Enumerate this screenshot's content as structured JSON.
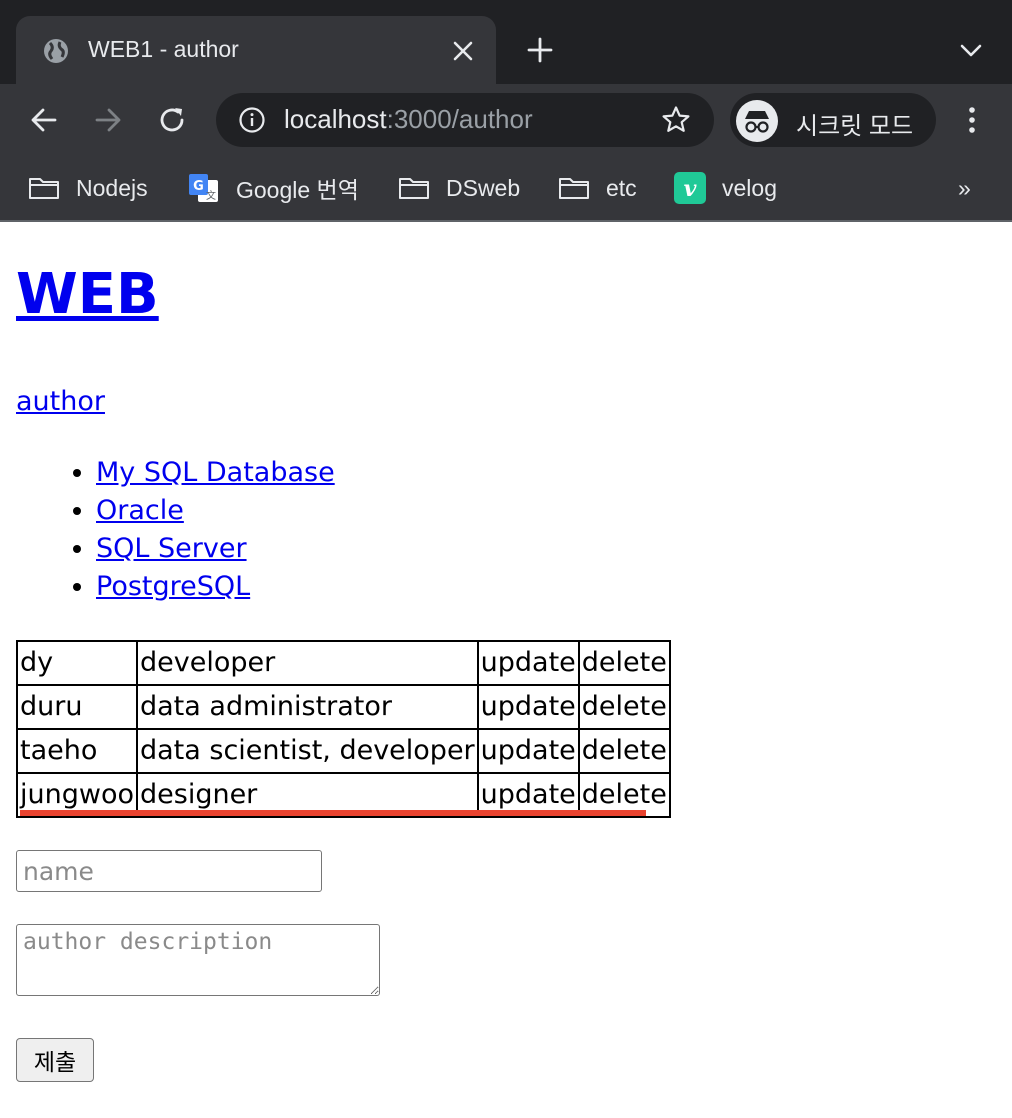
{
  "browser": {
    "tab_title": "WEB1 - author",
    "url_host": "localhost",
    "url_rest": ":3000/author",
    "incognito_label": "시크릿 모드",
    "bookmarks": [
      {
        "label": "Nodejs",
        "icon": "folder-icon"
      },
      {
        "label": "Google 번역",
        "icon": "google-translate-icon"
      },
      {
        "label": "DSweb",
        "icon": "folder-icon"
      },
      {
        "label": "etc",
        "icon": "folder-icon"
      },
      {
        "label": "velog",
        "icon": "velog-icon"
      }
    ],
    "bookmarks_more": "»",
    "colors": {
      "chrome_dark": "#202124",
      "chrome_toolbar": "#35363a",
      "velog_green": "#20c997"
    }
  },
  "page": {
    "title": "WEB",
    "author_link": "author",
    "databases": [
      "My SQL Database",
      "Oracle",
      "SQL Server",
      "PostgreSQL"
    ],
    "authors": [
      {
        "name": "dy",
        "profile": "developer",
        "update": "update",
        "delete": "delete"
      },
      {
        "name": "duru",
        "profile": "data administrator",
        "update": "update",
        "delete": "delete"
      },
      {
        "name": "taeho",
        "profile": "data scientist, developer",
        "update": "update",
        "delete": "delete"
      },
      {
        "name": "jungwoo",
        "profile": "designer",
        "update": "update",
        "delete": "delete"
      }
    ],
    "form": {
      "name_placeholder": "name",
      "description_placeholder": "author description",
      "submit_label": "제출"
    },
    "colors": {
      "link": "#0000ee",
      "highlight_underline": "#e8432f"
    }
  }
}
